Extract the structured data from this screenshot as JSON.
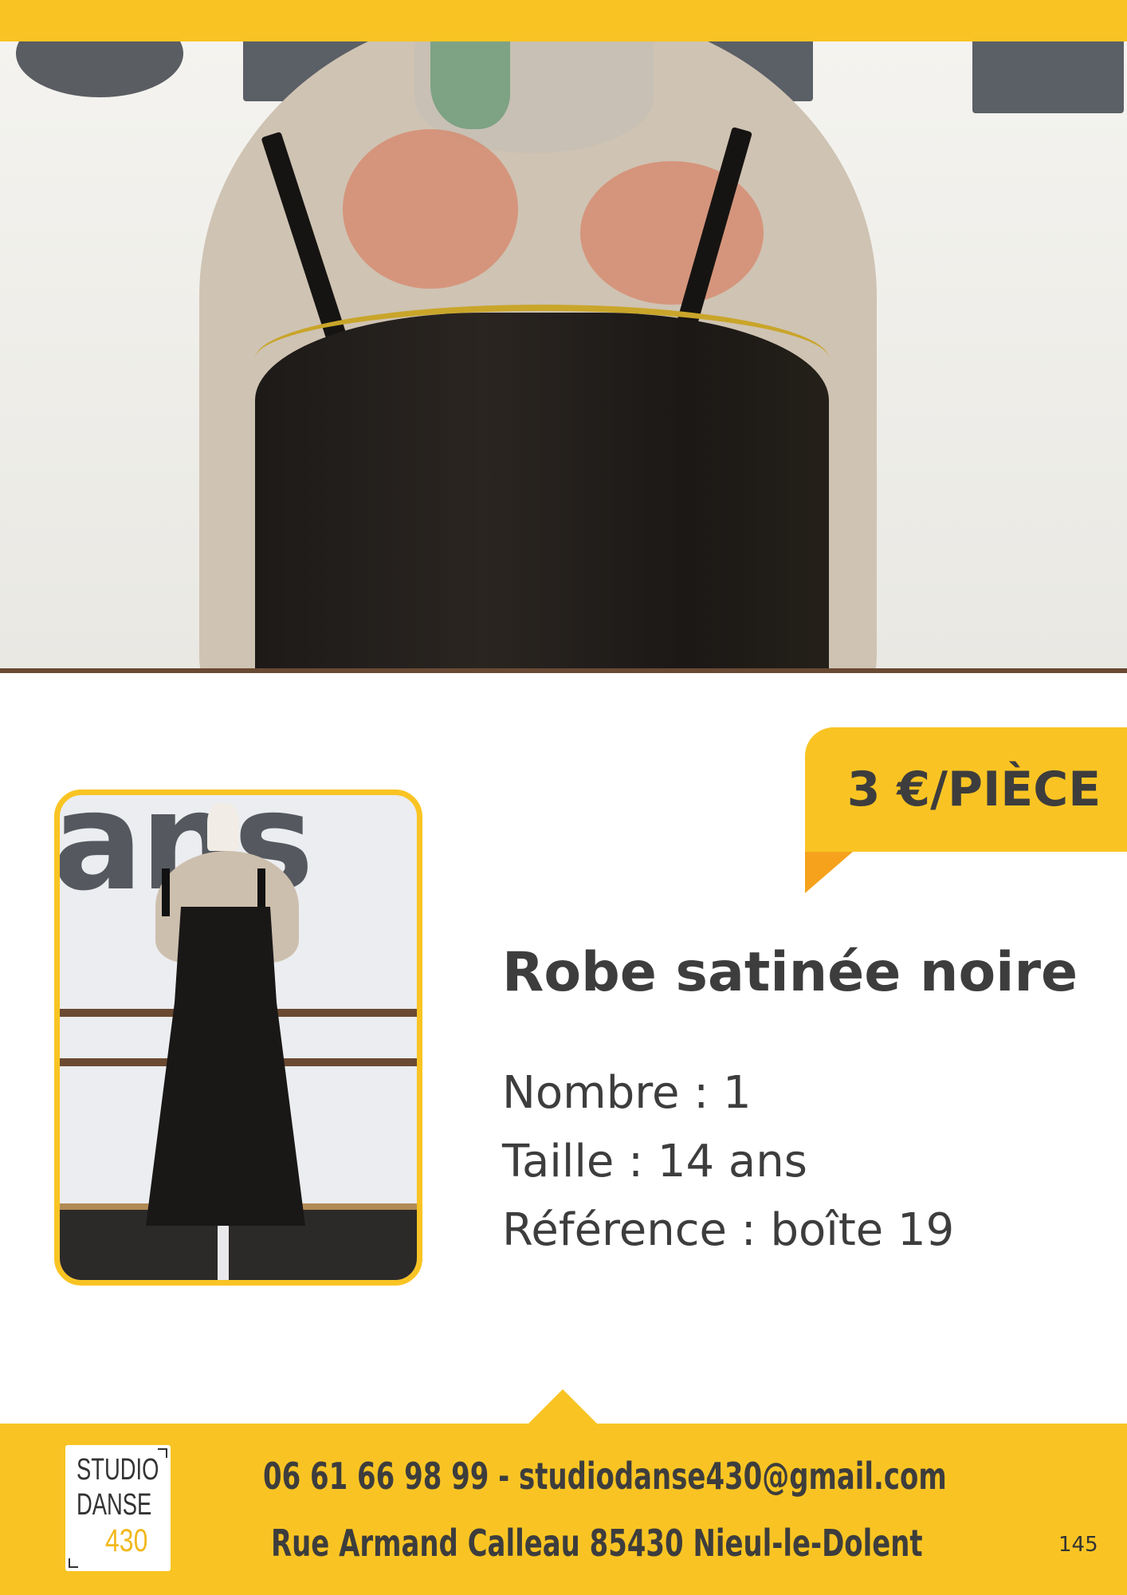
{
  "price": {
    "label": "3 €/PIÈCE"
  },
  "product": {
    "title": "Robe satinée noire",
    "specs": [
      {
        "text": "Nombre : 1"
      },
      {
        "text": "Taille : 14 ans"
      },
      {
        "text": "Référence : boîte 19"
      }
    ]
  },
  "footer": {
    "logo": {
      "line1": "STUDIO",
      "line2": "DANSE",
      "line3": "430"
    },
    "contact_line": "06 61 66 98 99 - studiodanse430@gmail.com",
    "address_line": "Rue Armand Calleau 85430 Nieul-le-Dolent",
    "page_number": "145"
  },
  "colors": {
    "accent": "#f9c423",
    "accent_dark": "#f6a21d",
    "text": "#3d3d3d"
  }
}
